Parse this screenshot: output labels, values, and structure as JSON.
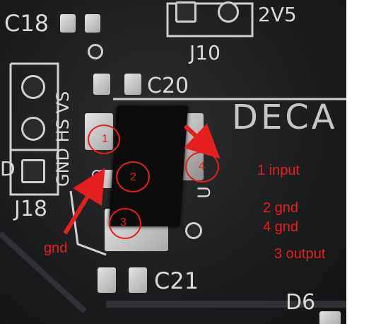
{
  "silkscreen": {
    "c18": "C18",
    "v25": "2V5",
    "j10": "J10",
    "c20": "C20",
    "deca": "DECA",
    "j18": "J18",
    "gnd_hs_vs": "GND HS VS",
    "c21": "C21",
    "d6": "D6",
    "u_partial": "U",
    "d_partial": "D"
  },
  "markers": [
    "1",
    "2",
    "3",
    "4"
  ],
  "annotations": {
    "gnd": "gnd",
    "pin1": "1 input",
    "pin2": "2 gnd",
    "pin4": "4 gnd",
    "pin3": "3 output"
  },
  "colors": {
    "annotation": "#e51e1e",
    "board": "#1e2022",
    "silkscreen": "#d8d8d8",
    "pad": "#c8c8c8"
  }
}
